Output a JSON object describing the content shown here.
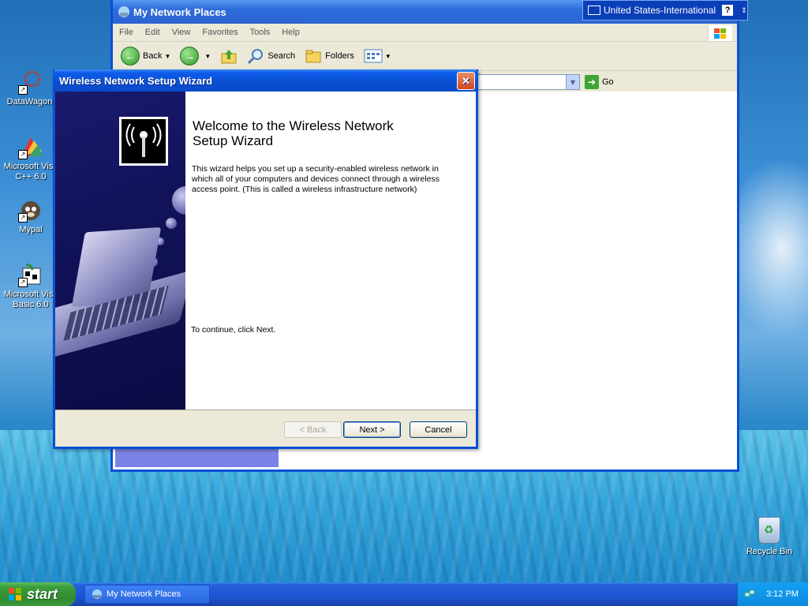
{
  "desktop": {
    "icons": [
      {
        "label": "DataWagon."
      },
      {
        "label": "Microsoft Visu C++ 6.0"
      },
      {
        "label": "Mypal"
      },
      {
        "label": "Microsoft Visu Basic 6.0"
      }
    ],
    "recycle_bin": "Recycle Bin"
  },
  "explorer": {
    "title": "My Network Places",
    "menu": [
      "File",
      "Edit",
      "View",
      "Favorites",
      "Tools",
      "Help"
    ],
    "toolbar": {
      "back": "Back",
      "search": "Search",
      "folders": "Folders"
    },
    "go": "Go"
  },
  "language_bar": {
    "language": "United States-International",
    "help": "?"
  },
  "wizard": {
    "title": "Wireless Network Setup Wizard",
    "heading": "Welcome to the Wireless Network Setup Wizard",
    "description": "This wizard helps you set up a security-enabled wireless network in which all of your computers and devices connect through a wireless access point. (This is called a wireless infrastructure network)",
    "continue_text": "To continue, click Next.",
    "buttons": {
      "back": "< Back",
      "next": "Next >",
      "cancel": "Cancel"
    }
  },
  "taskbar": {
    "start": "start",
    "task": "My Network Places",
    "clock": "3:12 PM"
  }
}
